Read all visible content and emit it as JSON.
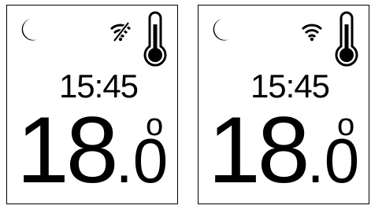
{
  "panels": [
    {
      "wifi": "wifi-off-icon",
      "time": "15:45",
      "temp_int": "18",
      "temp_dec": ".0",
      "degree": "o"
    },
    {
      "wifi": "wifi-icon",
      "time": "15:45",
      "temp_int": "18",
      "temp_dec": ".0",
      "degree": "o"
    }
  ]
}
